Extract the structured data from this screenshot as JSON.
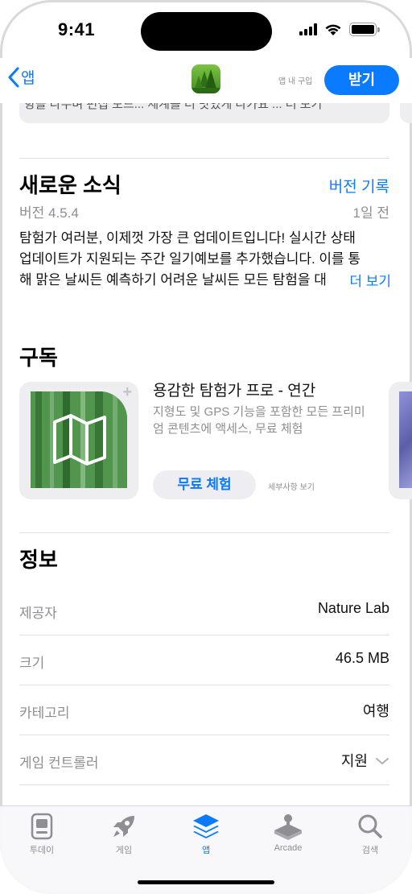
{
  "status_bar": {
    "time": "9:41"
  },
  "nav": {
    "back_label": "앱",
    "in_app_purchase": "앱 내 구입",
    "get_label": "받기"
  },
  "top_snippet": "항을 나누며 편집 모드... 세계를 더 맛있게 나가요 ... 더 보기",
  "whats_new": {
    "title": "새로운 소식",
    "history_link": "버전 기록",
    "version": "버전 4.5.4",
    "date": "1일 전",
    "notes_lines": [
      "탐험가 여러분, 이제껏 가장 큰 업데이트입니다! 실시간 상태",
      "업데이트가 지원되는 주간 일기예보를 추가했습니다. 이를 통",
      "해 맑은 날씨든 예측하기 어려운 날씨든 모든 탐험을 대"
    ],
    "more_label": "더 보기"
  },
  "subscription": {
    "title": "구독",
    "name": "용감한 탐험가 프로 - 연간",
    "description": "지형도 및 GPS 기능을 포함한 모든 프리미엄 콘텐츠에 액세스, 무료 체험",
    "trial_button": "무료 체험",
    "terms_link": "세부사항 보기"
  },
  "information": {
    "title": "정보",
    "rows": [
      {
        "key": "제공자",
        "value": "Nature Lab"
      },
      {
        "key": "크기",
        "value": "46.5 MB"
      },
      {
        "key": "카테고리",
        "value": "여행"
      },
      {
        "key": "게임 컨트롤러",
        "value": "지원"
      }
    ]
  },
  "tabbar": {
    "tabs": [
      {
        "label": "투데이",
        "icon": "today-icon"
      },
      {
        "label": "게임",
        "icon": "rocket-icon"
      },
      {
        "label": "앱",
        "icon": "apps-stack-icon"
      },
      {
        "label": "Arcade",
        "icon": "joystick-icon"
      },
      {
        "label": "검색",
        "icon": "search-icon"
      }
    ],
    "active_index": 2
  },
  "colors": {
    "accent": "#0a7aff",
    "secondary_text": "#8e8e93",
    "card_bg": "#eeeef0"
  }
}
